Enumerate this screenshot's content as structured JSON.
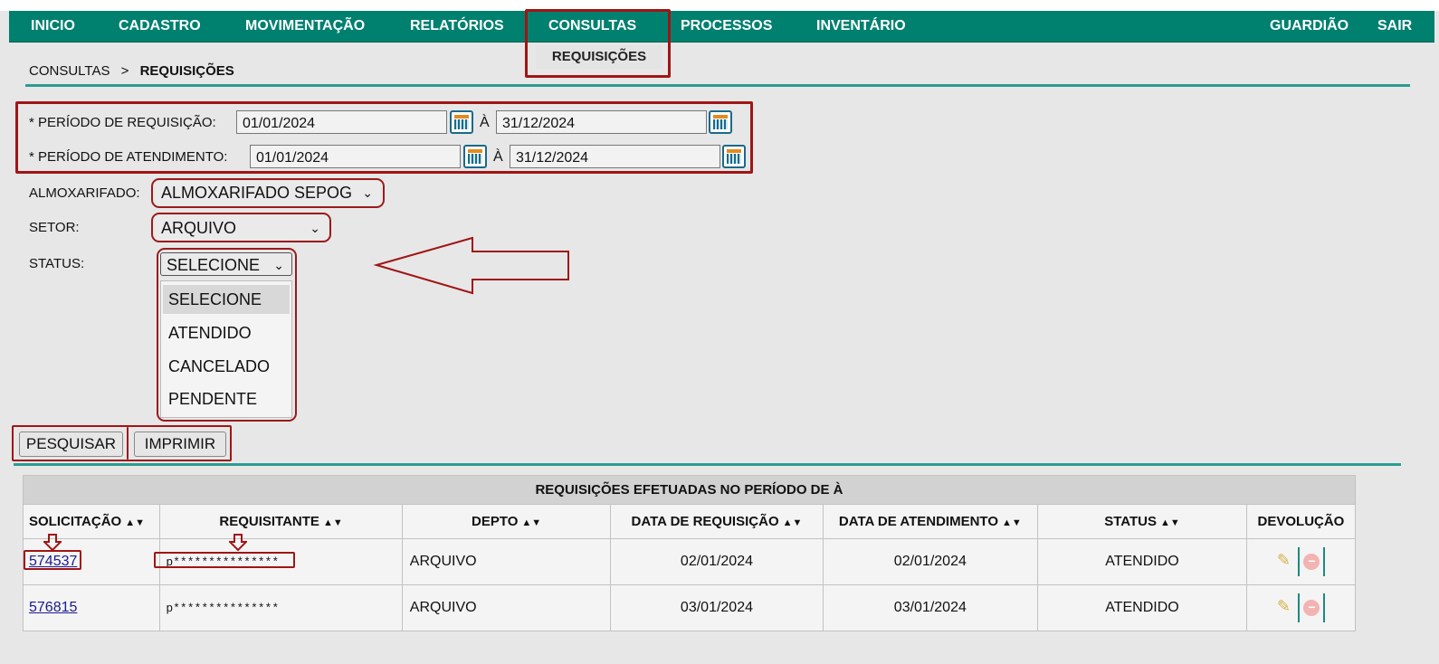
{
  "nav": {
    "items": [
      "INICIO",
      "CADASTRO",
      "MOVIMENTAÇÃO",
      "RELATÓRIOS",
      "CONSULTAS",
      "PROCESSOS",
      "INVENTÁRIO"
    ],
    "right_items": [
      "GUARDIÃO",
      "SAIR"
    ],
    "submenu_item": "REQUISIÇÕES"
  },
  "breadcrumb": {
    "parent": "CONSULTAS",
    "separator": ">",
    "current": "REQUISIÇÕES"
  },
  "filters": {
    "req_period_label": "* PERÍODO DE REQUISIÇÃO:",
    "req_from": "01/01/2024",
    "req_sep": "À",
    "req_to": "31/12/2024",
    "att_period_label": "* PERÍODO DE ATENDIMENTO:",
    "att_from": "01/01/2024",
    "att_sep": "À",
    "att_to": "31/12/2024",
    "almox_label": "ALMOXARIFADO:",
    "almox_value": "ALMOXARIFADO SEPOG",
    "setor_label": "SETOR:",
    "setor_value": "ARQUIVO",
    "status_label": "STATUS:",
    "status_value": "SELECIONE",
    "status_options": [
      "SELECIONE",
      "ATENDIDO",
      "CANCELADO",
      "PENDENTE"
    ]
  },
  "buttons": {
    "search": "PESQUISAR",
    "print": "IMPRIMIR"
  },
  "table": {
    "caption": "REQUISIÇÕES EFETUADAS NO PERÍODO DE À",
    "headers": [
      "SOLICITAÇÃO",
      "REQUISITANTE",
      "DEPTO",
      "DATA DE REQUISIÇÃO",
      "DATA DE ATENDIMENTO",
      "STATUS",
      "DEVOLUÇÃO"
    ],
    "rows": [
      {
        "id": "574537",
        "requester": "p***************",
        "dept": "ARQUIVO",
        "req_date": "02/01/2024",
        "att_date": "02/01/2024",
        "status": "ATENDIDO"
      },
      {
        "id": "576815",
        "requester": "p***************",
        "dept": "ARQUIVO",
        "req_date": "03/01/2024",
        "att_date": "03/01/2024",
        "status": "ATENDIDO"
      }
    ]
  },
  "colors": {
    "nav_bg": "#00806f",
    "highlight": "#a01515",
    "rule": "#2a9d92"
  }
}
